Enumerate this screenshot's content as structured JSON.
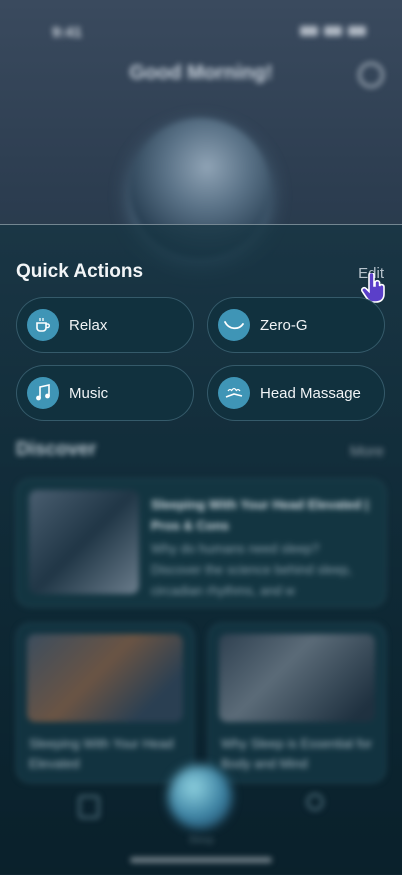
{
  "status_bar": {
    "time": "9:41"
  },
  "header": {
    "greeting": "Good Morning!"
  },
  "quick_actions": {
    "title": "Quick Actions",
    "edit_label": "Edit",
    "items": [
      {
        "label": "Relax",
        "icon": "coffee-cup-icon"
      },
      {
        "label": "Zero-G",
        "icon": "zero-g-icon"
      },
      {
        "label": "Music",
        "icon": "music-note-icon"
      },
      {
        "label": "Head Massage",
        "icon": "head-massage-icon"
      }
    ]
  },
  "discover": {
    "title": "Discover",
    "more_label": "More",
    "featured": {
      "title": "Sleeping With Your Head Elevated | Pros & Cons",
      "excerpt": "Why do humans need sleep? Discover the science behind sleep, circadian rhythms, and w"
    },
    "cards": [
      {
        "title": "Sleeping With Your Head Elevated"
      },
      {
        "title": "Why Sleep is Essential for Body and Mind"
      }
    ]
  },
  "bottom_nav": {
    "center_label": "Sleep"
  },
  "colors": {
    "accent": "#3f95b6",
    "pointer": "#6a4bd6"
  }
}
